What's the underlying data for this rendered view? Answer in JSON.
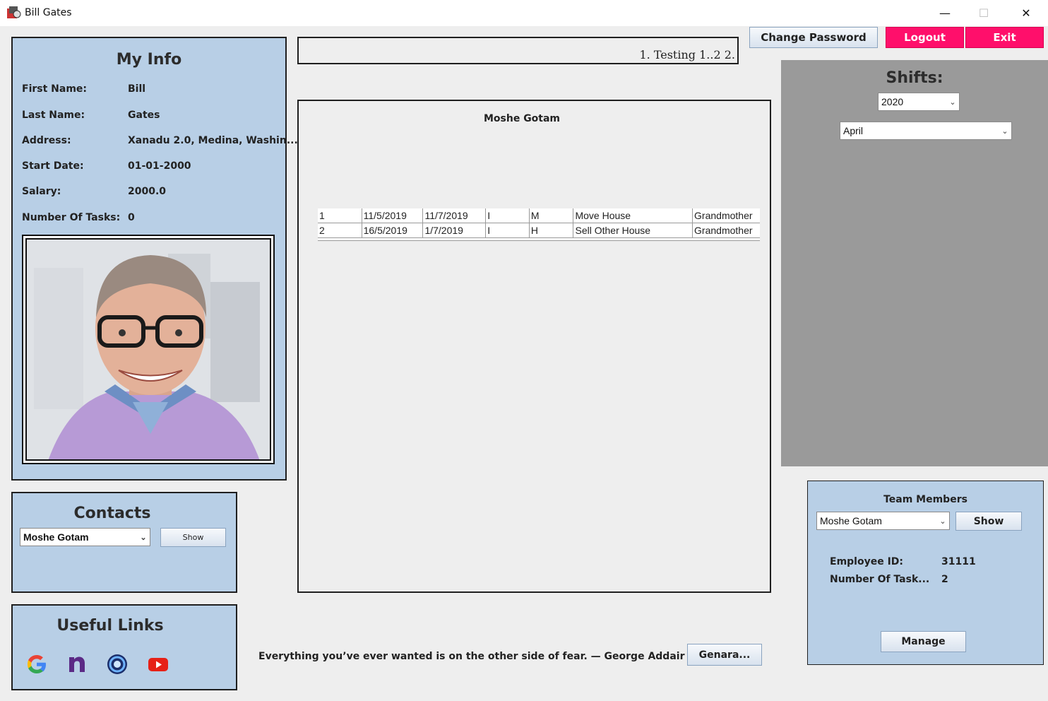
{
  "window": {
    "title": "Bill Gates",
    "minimize": "—",
    "maximize": "☐",
    "close": "✕"
  },
  "toolbar": {
    "change_password": "Change Password",
    "logout": "Logout",
    "exit": "Exit"
  },
  "my_info": {
    "title": "My Info",
    "fields": [
      {
        "label": "First Name:",
        "value": "Bill"
      },
      {
        "label": "Last Name:",
        "value": "Gates"
      },
      {
        "label": "Address:",
        "value": "Xanadu 2.0, Medina, Washin..."
      },
      {
        "label": "Start Date:",
        "value": "01-01-2000"
      },
      {
        "label": "Salary:",
        "value": "2000.0"
      },
      {
        "label": "Number Of Tasks:",
        "value": "0"
      }
    ]
  },
  "notice": {
    "text": "1. Testing 1..2 2."
  },
  "center": {
    "name": "Moshe Gotam",
    "rows": [
      [
        "1",
        "11/5/2019",
        "11/7/2019",
        "I",
        "M",
        "Move House",
        "Grandmother"
      ],
      [
        "2",
        "16/5/2019",
        "1/7/2019",
        "I",
        "H",
        "Sell Other House",
        "Grandmother"
      ]
    ]
  },
  "shifts": {
    "title": "Shifts:",
    "year": "2020",
    "month": "April"
  },
  "contacts": {
    "title": "Contacts",
    "selected": "Moshe Gotam",
    "show": "Show"
  },
  "useful_links": {
    "title": "Useful Links",
    "icons": [
      "google-icon",
      "n-app-icon",
      "blue-ring-icon",
      "youtube-icon"
    ]
  },
  "quote": {
    "text": "Everything you’ve ever wanted is on the other side of fear. — George Addair"
  },
  "generate": {
    "label": "Genara..."
  },
  "team": {
    "title": "Team Members",
    "selected": "Moshe Gotam",
    "show": "Show",
    "employee_id_label": "Employee ID:",
    "employee_id": "31111",
    "tasks_label": "Number Of Task...",
    "tasks": "2",
    "manage": "Manage"
  },
  "colors": {
    "panel": "#b8cfe6",
    "accent_pink": "#ff0f6b",
    "shifts_bg": "#9a9a9a"
  }
}
